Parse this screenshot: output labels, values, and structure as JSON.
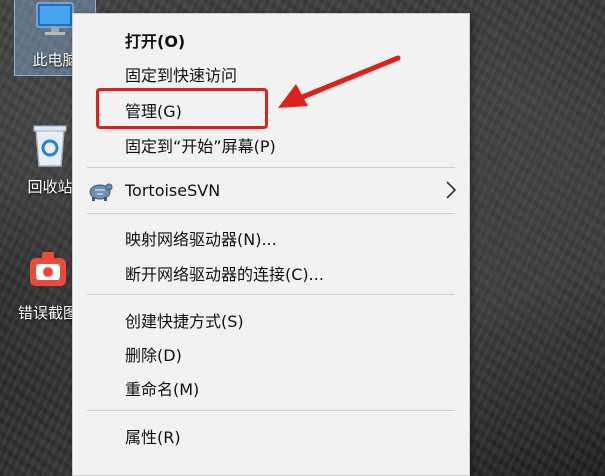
{
  "desktop": {
    "icons": [
      {
        "label": "此电脑",
        "icon": "this-pc-icon"
      },
      {
        "label": "回收站",
        "icon": "recycle-bin-icon"
      },
      {
        "label": "错误截图",
        "icon": "screenshot-tool-icon"
      }
    ]
  },
  "context_menu": {
    "items": [
      {
        "label": "打开(O)",
        "bold": true
      },
      {
        "label": "固定到快速访问"
      },
      {
        "label": "管理(G)",
        "highlighted_by_annotation": true
      },
      {
        "label": "固定到“开始”屏幕(P)"
      },
      {
        "label": "TortoiseSVN",
        "icon": "tortoisesvn-icon",
        "submenu": true
      },
      {
        "label": "映射网络驱动器(N)..."
      },
      {
        "label": "断开网络驱动器的连接(C)..."
      },
      {
        "label": "创建快捷方式(S)"
      },
      {
        "label": "删除(D)"
      },
      {
        "label": "重命名(M)"
      },
      {
        "label": "属性(R)"
      }
    ]
  },
  "annotation": {
    "color": "#e0201a",
    "shape": "box-and-arrow"
  }
}
